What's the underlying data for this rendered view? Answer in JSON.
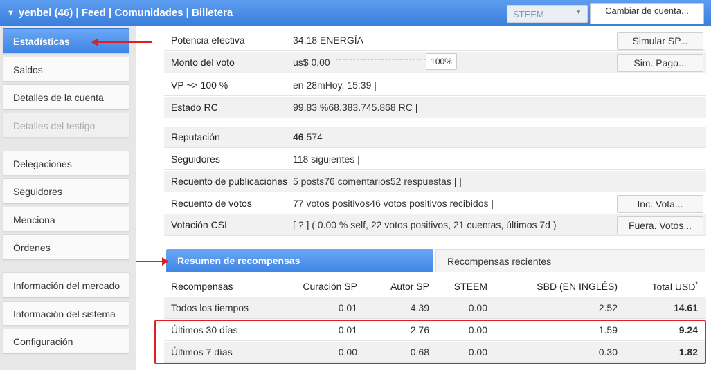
{
  "header": {
    "title": "yenbel (46) | Feed | Comunidades | Billetera",
    "select_value": "STEEM",
    "switch_button": "Cambiar de cuenta..."
  },
  "sidebar": {
    "items": [
      {
        "label": "Estadísticas"
      },
      {
        "label": "Saldos"
      },
      {
        "label": "Detalles de la cuenta"
      },
      {
        "label": "Detalles del testigo"
      },
      {
        "label": "Delegaciones"
      },
      {
        "label": "Seguidores"
      },
      {
        "label": "Menciona"
      },
      {
        "label": "Órdenes"
      },
      {
        "label": "Información del mercado"
      },
      {
        "label": "Información del sistema"
      },
      {
        "label": "Configuración"
      }
    ]
  },
  "stats": {
    "effective_power": {
      "label": "Potencia efectiva",
      "value": "34,18 ENERGÍA",
      "button": "Simular SP..."
    },
    "vote_amount": {
      "label": "Monto del voto",
      "value": "us$ 0,00",
      "percent": "100%",
      "button": "Sim. Pago..."
    },
    "vp": {
      "label": "VP ~> 100 %",
      "value": "en 28mHoy, 15:39  |"
    },
    "rc": {
      "label": "Estado RC",
      "value": "99,83 %68.383.745.868 RC  |"
    },
    "reputation": {
      "label": "Reputación",
      "value_bold": "46",
      "value_rest": ".574"
    },
    "followers": {
      "label": "Seguidores",
      "value": "118 siguientes  |"
    },
    "posts": {
      "label": "Recuento de publicaciones",
      "value": "5 posts76 comentarios52 respuestas  |   |"
    },
    "votes": {
      "label": "Recuento de votos",
      "value": "77 votos positivos46 votos positivos recibidos  |",
      "button": "Inc. Vota..."
    },
    "csi": {
      "label": "Votación CSI",
      "value": "[ ? ] ( 0.00 % self, 22 votos positivos, 21 cuentas, últimos 7d )",
      "button": "Fuera. Votos..."
    }
  },
  "rewards": {
    "tab_active": "Resumen de recompensas",
    "tab_inactive": "Recompensas recientes",
    "columns": [
      "Recompensas",
      "Curación SP",
      "Autor SP",
      "STEEM",
      "SBD (EN INGLÉS)",
      "Total USD",
      "*"
    ],
    "rows": [
      [
        "Todos los tiempos",
        "0.01",
        "4.39",
        "0.00",
        "2.52",
        "14.61"
      ],
      [
        "Últimos 30 días",
        "0.01",
        "2.76",
        "0.00",
        "1.59",
        "9.24"
      ],
      [
        "Últimos 7 días",
        "0.00",
        "0.68",
        "0.00",
        "0.30",
        "1.82"
      ]
    ]
  },
  "colors": {
    "accent": "#3f86e6",
    "annotation": "#e02020"
  }
}
